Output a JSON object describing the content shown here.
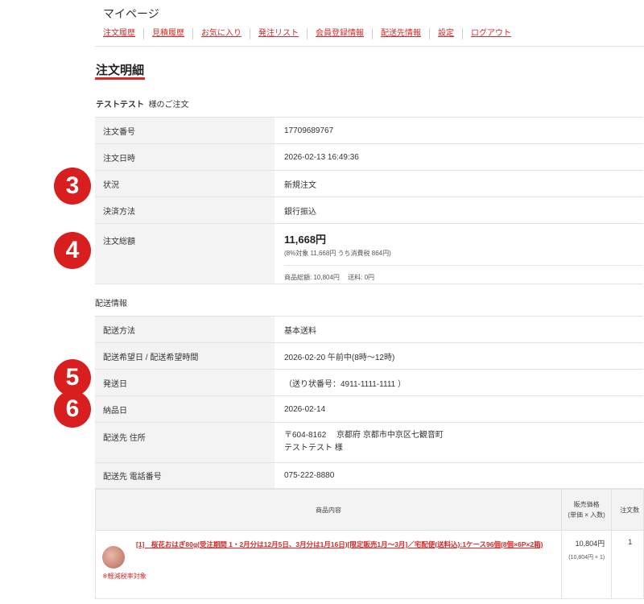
{
  "header": {
    "mypage_title": "マイページ",
    "nav": [
      "注文履歴",
      "見積履歴",
      "お気に入り",
      "発注リスト",
      "会員登録情報",
      "配送先情報",
      "設定",
      "ログアウト"
    ]
  },
  "order": {
    "section_title": "注文明細",
    "customer_name": "テストテスト",
    "customer_suffix": "様のご注文",
    "rows": {
      "order_no_label": "注文番号",
      "order_no": "17709689767",
      "order_date_label": "注文日時",
      "order_date": "2026-02-13 16:49:36",
      "status_label": "状況",
      "status": "新規注文",
      "payment_label": "決済方法",
      "payment": "銀行振込",
      "total_label": "注文総額",
      "total": "11,668円",
      "total_tax_note": "(8%対象 11,668円 うち消費税 864円)",
      "total_breakdown": "商品総額: 10,804円　 送料: 0円"
    }
  },
  "delivery": {
    "section_label": "配送情報",
    "rows": {
      "method_label": "配送方法",
      "method": "基本送料",
      "desired_label": "配送希望日 / 配送希望時間",
      "desired": "2026-02-20 午前中(8時～12時)",
      "ship_date_label": "発送日",
      "ship_date": "（送り状番号：4911-1111-1111 ）",
      "delivery_date_label": "納品日",
      "delivery_date": "2026-02-14",
      "address_label": "配送先 住所",
      "address_line1": "〒604-8162　 京都府 京都市中京区七観音町",
      "address_line2": "テストテスト 様",
      "phone_label": "配送先 電話番号",
      "phone": "075-222-8880"
    }
  },
  "items": {
    "header_content": "商品内容",
    "header_price": "販売価格",
    "header_price_sub": "(単価 × 入数)",
    "header_qty": "注文数",
    "product_name": "[1]　桜花おはぎ80g(受注期間 1・2月分は12月5日、3月分は1月16日)[限定販売1月～3月]／宅配便(送料込):1ケース96個(8個×6P×2箱)",
    "product_note": "※軽減税率対象",
    "price": "10,804円",
    "price_sub": "(10,804円 × 1)",
    "qty": "1"
  },
  "badges": [
    "3",
    "4",
    "5",
    "6"
  ],
  "colors": {
    "accent": "#d42b2b",
    "badge": "#d81e1e",
    "label_bg": "#f3f3f3"
  }
}
